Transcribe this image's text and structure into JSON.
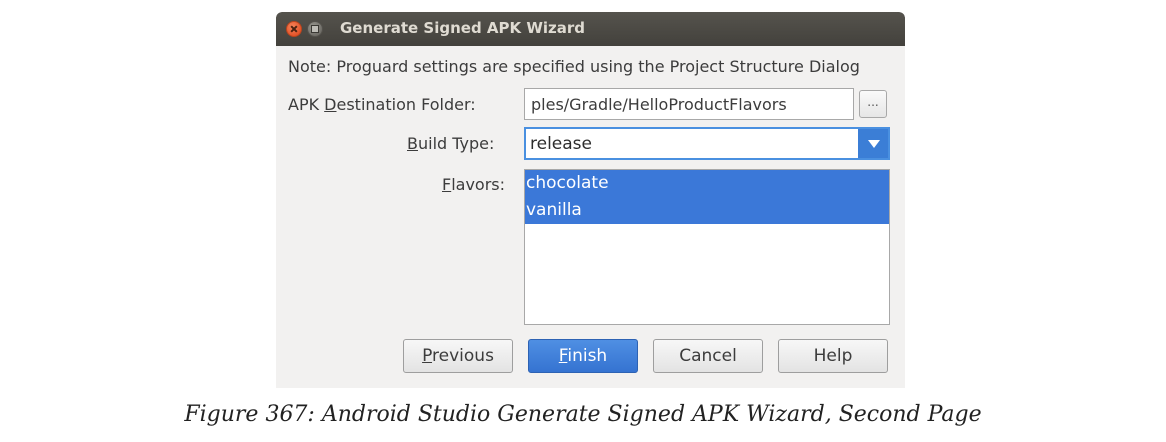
{
  "window": {
    "title": "Generate Signed APK Wizard"
  },
  "note": "Note: Proguard settings are specified using the Project Structure Dialog",
  "destination": {
    "label_pre": "APK ",
    "label_mnemonic": "D",
    "label_post": "estination Folder:",
    "value": "ples/Gradle/HelloProductFlavors",
    "browse_label": "..."
  },
  "build_type": {
    "label_mnemonic": "B",
    "label_post": "uild Type:",
    "selected": "release"
  },
  "flavors": {
    "label_mnemonic": "F",
    "label_post": "lavors:",
    "items": [
      "chocolate",
      "vanilla"
    ]
  },
  "buttons": {
    "previous_mnemonic": "P",
    "previous_rest": "revious",
    "finish_mnemonic": "F",
    "finish_rest": "inish",
    "cancel": "Cancel",
    "help": "Help"
  },
  "caption": "Figure 367: Android Studio Generate Signed APK Wizard, Second Page",
  "colors": {
    "selection": "#3b78d8",
    "focus_border": "#4a90e0",
    "titlebar": "#4a4842"
  }
}
